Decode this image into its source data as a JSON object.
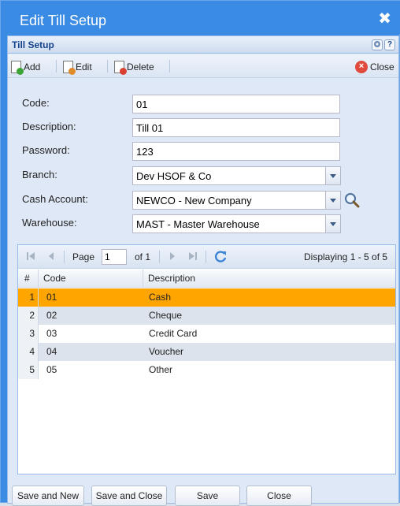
{
  "window": {
    "title": "Edit Till Setup",
    "close_glyph": "✖"
  },
  "panel": {
    "title": "Till Setup"
  },
  "toolbar": {
    "add_label": "Add",
    "edit_label": "Edit",
    "delete_label": "Delete",
    "close_label": "Close"
  },
  "form": {
    "code": {
      "label": "Code:",
      "value": "01"
    },
    "description": {
      "label": "Description:",
      "value": "Till 01"
    },
    "password": {
      "label": "Password:",
      "value": "123"
    },
    "branch": {
      "label": "Branch:",
      "value": "Dev HSOF & Co"
    },
    "cash_account": {
      "label": "Cash Account:",
      "value": "NEWCO - New Company"
    },
    "warehouse": {
      "label": "Warehouse:",
      "value": "MAST - Master Warehouse"
    }
  },
  "pager": {
    "page_label": "Page",
    "page_value": "1",
    "of_label": "of 1",
    "displaying": "Displaying 1 - 5 of 5"
  },
  "grid": {
    "columns": [
      "#",
      "Code",
      "Description"
    ],
    "rows": [
      {
        "n": "1",
        "code": "01",
        "description": "Cash"
      },
      {
        "n": "2",
        "code": "02",
        "description": "Cheque"
      },
      {
        "n": "3",
        "code": "03",
        "description": "Credit Card"
      },
      {
        "n": "4",
        "code": "04",
        "description": "Voucher"
      },
      {
        "n": "5",
        "code": "05",
        "description": "Other"
      }
    ]
  },
  "footer": {
    "save_and_new": "Save and New",
    "save_and_close": "Save and Close",
    "save": "Save",
    "close": "Close"
  },
  "colors": {
    "accent": "#3a8be3",
    "selected_row": "#ffa500"
  }
}
